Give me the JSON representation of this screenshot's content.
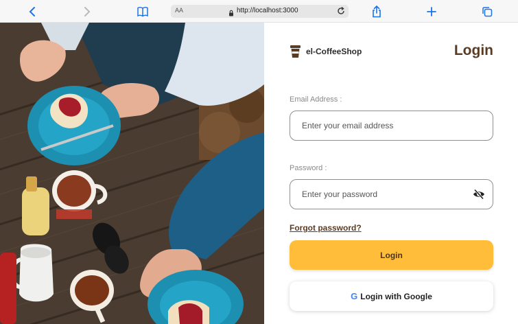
{
  "browser": {
    "text_size_label": "AA",
    "url": "http://localhost:3000",
    "icons": [
      "back-icon",
      "forward-icon",
      "bookmarks-icon",
      "lock-icon",
      "reload-icon",
      "share-icon",
      "new-tab-icon",
      "tabs-icon"
    ]
  },
  "brand": {
    "name": "el-CoffeeShop",
    "icon": "coffee-cup-icon"
  },
  "login": {
    "title": "Login",
    "email_label": "Email Address :",
    "email_placeholder": "Enter your email address",
    "email_value": "",
    "password_label": "Password :",
    "password_placeholder": "Enter your password",
    "password_value": "",
    "password_toggle_icon": "eye-slash-icon",
    "forgot_link": "Forgot password?",
    "login_button": "Login",
    "google_button": "Login with Google",
    "google_icon": "google-icon"
  },
  "colors": {
    "accent": "#ffbd3a",
    "brand_brown": "#5a3b23",
    "browser_blue": "#1a73e8"
  }
}
